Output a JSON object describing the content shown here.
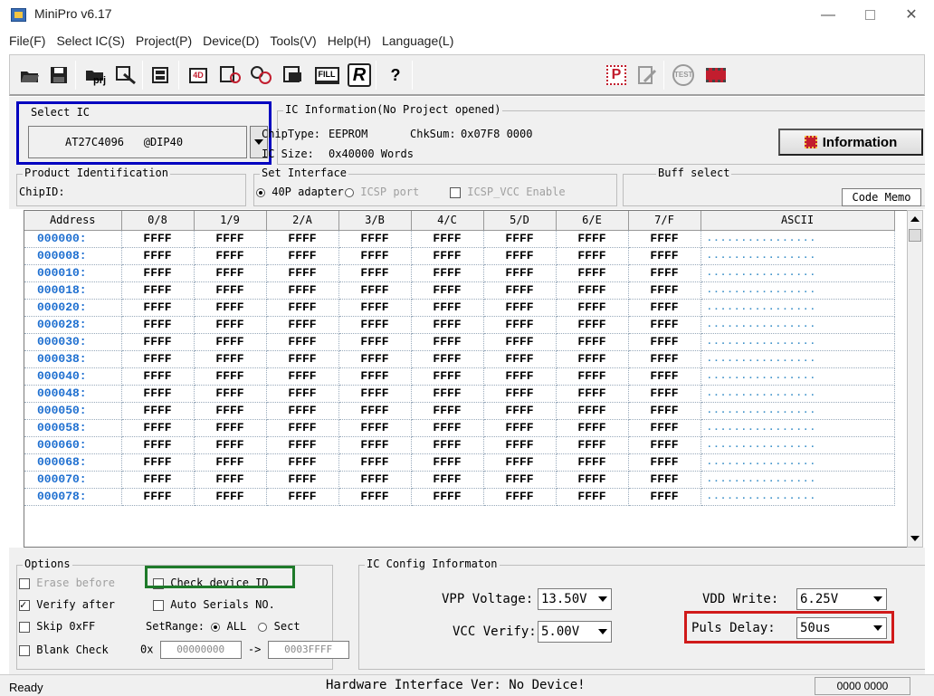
{
  "window": {
    "title": "MiniPro v6.17"
  },
  "menu": [
    "File(F)",
    "Select IC(S)",
    "Project(P)",
    "Device(D)",
    "Tools(V)",
    "Help(H)",
    "Language(L)"
  ],
  "toolbar": {
    "icons": [
      "open-icon",
      "save-icon",
      "open-project-icon",
      "save-project-icon",
      "memory-icon",
      "read-icon",
      "verify-icon",
      "program-icon",
      "erase-icon",
      "fill-icon",
      "read-chip-icon",
      "help-icon",
      "production-icon",
      "edit-icon",
      "test-icon",
      "chip-icon"
    ],
    "fill_label": "FILL",
    "read_label": "R",
    "prj_label": "prj",
    "test_label": "TEST",
    "p_label": "P"
  },
  "select_ic": {
    "title": "Select IC",
    "chip_name": "AT27C4096",
    "package": "@DIP40"
  },
  "ic_info": {
    "title": "IC Information(No Project opened)",
    "chip_type_label": "ChipType:",
    "chip_type": "EEPROM",
    "chksum_label": "ChkSum:",
    "chksum": "0x07F8 0000",
    "size_label": "IC Size:",
    "size": "0x40000 Words",
    "info_button": "Information"
  },
  "product_id": {
    "title": "Product Identification",
    "chip_id_label": "ChipID:"
  },
  "set_interface": {
    "title": "Set Interface",
    "adapter_label": "40P adapter",
    "icsp_label": "ICSP port",
    "icsp_vcc_label": "ICSP_VCC Enable"
  },
  "buff_select": {
    "title": "Buff select",
    "value": "Code Memo"
  },
  "grid": {
    "headers": [
      "Address",
      "0/8",
      "1/9",
      "2/A",
      "3/B",
      "4/C",
      "5/D",
      "6/E",
      "7/F",
      "ASCII"
    ],
    "addresses": [
      "000000:",
      "000008:",
      "000010:",
      "000018:",
      "000020:",
      "000028:",
      "000030:",
      "000038:",
      "000040:",
      "000048:",
      "000050:",
      "000058:",
      "000060:",
      "000068:",
      "000070:",
      "000078:"
    ],
    "cell_value": "FFFF",
    "ascii_value": "................"
  },
  "options": {
    "title": "Options",
    "erase_before": "Erase before",
    "check_device_id": "Check device ID",
    "verify_after": "Verify after",
    "auto_serials": "Auto Serials NO.",
    "skip_ff": "Skip 0xFF",
    "set_range": "SetRange:",
    "all": "ALL",
    "sect": "Sect",
    "blank_check": "Blank Check",
    "range_prefix": "0x",
    "range_start": "00000000",
    "range_arrow": "->",
    "range_end": "0003FFFF"
  },
  "ic_config": {
    "title": "IC Config Informaton",
    "vpp_label": "VPP Voltage:",
    "vpp_value": "13.50V",
    "vcc_label": "VCC Verify:",
    "vcc_value": "5.00V",
    "vdd_label": "VDD Write:",
    "vdd_value": "6.25V",
    "puls_label": "Puls Delay:",
    "puls_value": "50us"
  },
  "status": {
    "ready": "Ready",
    "hardware": "Hardware Interface Ver: No Device!",
    "count": "0000 0000"
  },
  "colors": {
    "select_highlight": "#0000c0",
    "check_id_highlight": "#1e7a2a",
    "puls_highlight": "#d01a1a",
    "address_color": "#1e6fd0"
  }
}
